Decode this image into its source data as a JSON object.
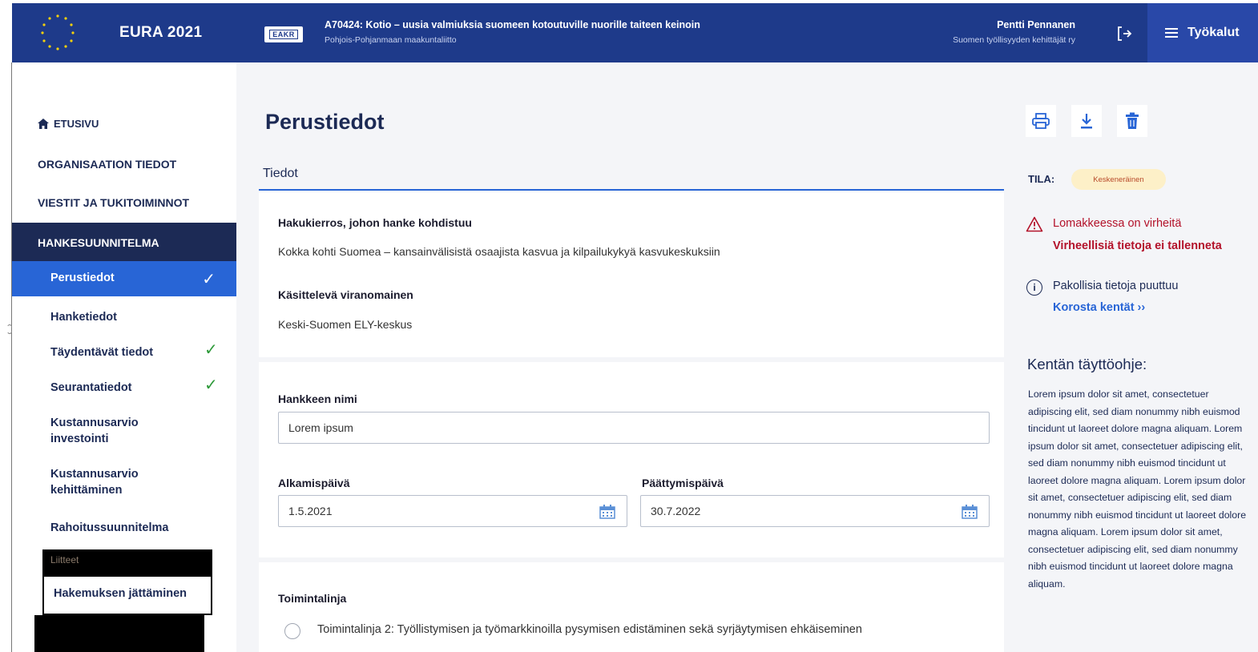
{
  "header": {
    "app_title": "EURA 2021",
    "fund_badge": "EAKR",
    "project_title": "A70424: Kotio – uusia valmiuksia suomeen kotoutuville nuorille taiteen keinoin",
    "project_subtitle": "Pohjois-Pohjanmaan maakuntaliitto",
    "user_name": "Pentti Pennanen",
    "user_org": "Suomen työllisyyden kehittäjät ry",
    "tools_label": "Työkalut"
  },
  "sidebar": {
    "home": "ETUSIVU",
    "org": "ORGANISAATION TIEDOT",
    "messages": "VIESTIT JA TUKITOIMINNOT",
    "plan": "HANKESUUNNITELMA",
    "active_item": "Perustiedot",
    "items": [
      {
        "label": "Hanketiedot",
        "done": false
      },
      {
        "label": "Täydentävät tiedot",
        "done": true
      },
      {
        "label": "Seurantatiedot",
        "done": true
      },
      {
        "label": "Kustannusarvio investointi",
        "done": false
      },
      {
        "label": "Kustannusarvio kehittäminen",
        "done": false
      },
      {
        "label": "Rahoitussuunnitelma",
        "done": false
      }
    ],
    "redacted_item": "Liitteet",
    "submit_item": "Hakemuksen jättäminen"
  },
  "main": {
    "page_title": "Perustiedot",
    "section_tab": "Tiedot",
    "haku_label": "Hakukierros, johon hanke kohdistuu",
    "haku_value": "Kokka kohti Suomea – kansainvälisistä osaajista kasvua ja kilpailukykyä kasvukeskuksiin",
    "authority_label": "Käsittelevä viranomainen",
    "authority_value": "Keski-Suomen ELY-keskus",
    "name_label": "Hankkeen nimi",
    "name_value": "Lorem ipsum",
    "start_label": "Alkamispäivä",
    "start_value": "1.5.2021",
    "end_label": "Päättymispäivä",
    "end_value": "30.7.2022",
    "line_label": "Toimintalinja",
    "line_option": "Toimintalinja 2: Työllistymisen ja työmarkkinoilla pysymisen edistäminen sekä syrjäytymisen ehkäiseminen"
  },
  "right": {
    "status_label": "TILA:",
    "status_value": "Keskeneräinen",
    "error_line1": "Lomakkeessa on virheitä",
    "error_line2": "Virheellisiä tietoja ei tallenneta",
    "info_text": "Pakollisia tietoja puuttuu",
    "info_link": "Korosta kentät ››",
    "help_title": "Kentän täyttöohje:",
    "help_text": "Lorem ipsum dolor sit amet, consectetuer adipiscing elit, sed diam nonummy nibh euismod tincidunt ut laoreet dolore magna aliquam. Lorem ipsum dolor sit amet, consectetuer adipiscing elit, sed diam nonummy nibh euismod tincidunt ut laoreet dolore magna aliquam. Lorem ipsum dolor sit amet, consectetuer adipiscing elit, sed diam nonummy nibh euismod tincidunt ut laoreet dolore magna aliquam. Lorem ipsum dolor sit amet, consectetuer adipiscing elit, sed diam nonummy nibh euismod tincidunt ut laoreet dolore magna aliquam."
  },
  "colors": {
    "header": "#1e3a8a",
    "nav_dark": "#1c2a55",
    "nav_active": "#2865d6",
    "error": "#b3122a",
    "check": "#2e9a3a"
  },
  "icons": [
    "eu-flag-icon",
    "logout-icon",
    "menu-icon",
    "home-icon",
    "check-icon",
    "print-icon",
    "download-icon",
    "trash-icon",
    "warning-icon",
    "info-icon",
    "calendar-icon"
  ]
}
